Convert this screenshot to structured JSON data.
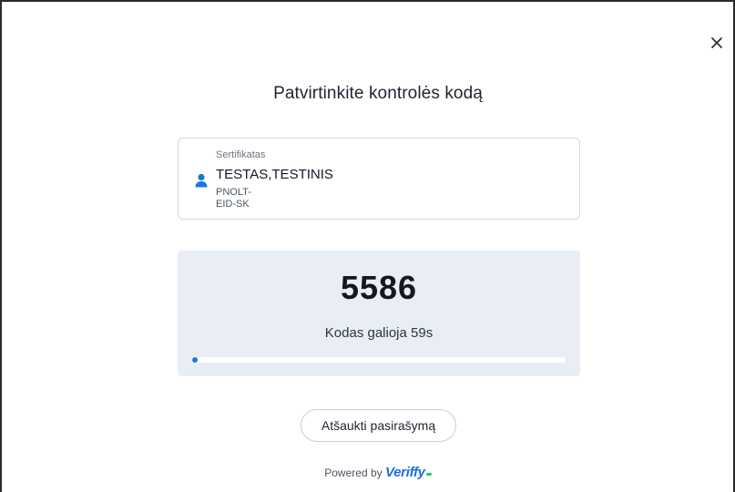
{
  "dialog": {
    "title": "Patvirtinkite kontrolės kodą",
    "close_icon": "close-icon"
  },
  "certificate": {
    "label": "Sertifikatas",
    "name": "TESTAS,TESTINIS",
    "line1": "PNOLT-",
    "line2": "EID-SK",
    "icon": "person-icon",
    "icon_color": "#1279e1"
  },
  "verification": {
    "code": "5586",
    "validity_text": "Kodas galioja 59s",
    "progress_fraction": 0.015,
    "progress_color": "#1279e1",
    "panel_color": "#e8eef3"
  },
  "actions": {
    "cancel_label": "Atšaukti pasirašymą"
  },
  "footer": {
    "powered_by": "Powered by",
    "brand": "Veriffy",
    "brand_color": "#1b6fd8",
    "brand_accent_color": "#2bc36b"
  }
}
